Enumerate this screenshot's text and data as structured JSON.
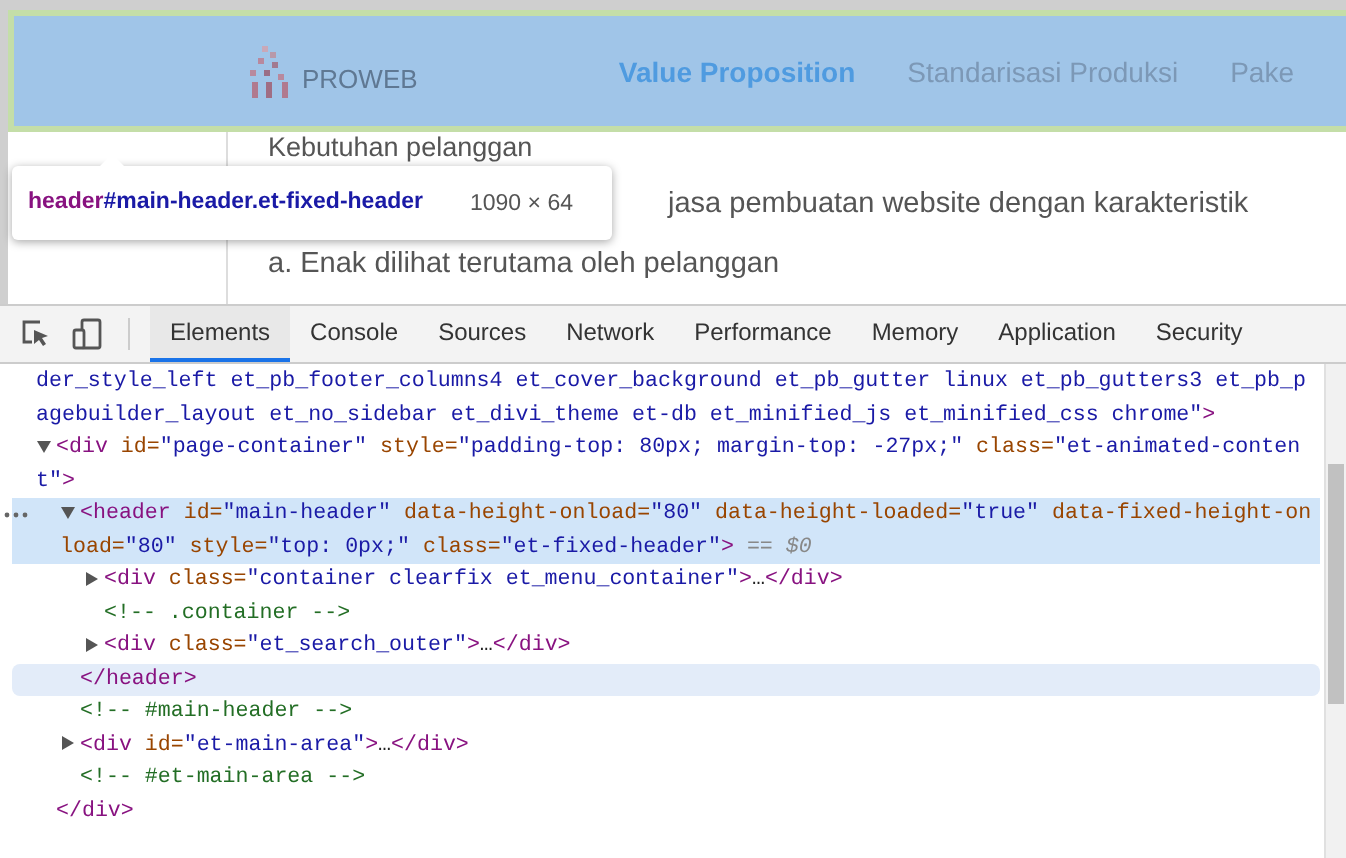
{
  "page": {
    "logo": "PROWEB",
    "nav": [
      {
        "label": "Value Proposition",
        "selected": true
      },
      {
        "label": "Standarisasi Produksi",
        "selected": false
      },
      {
        "label": "Pake",
        "selected": false
      }
    ],
    "content": [
      "Kebutuhan pelanggan",
      "jasa pembuatan website dengan karakteristik",
      "a. Enak dilihat terutama oleh pelanggan"
    ]
  },
  "tooltip": {
    "tag": "header",
    "selector": "#main-header.et-fixed-header",
    "size": "1090 × 64"
  },
  "devtools": {
    "tabs": [
      {
        "label": "Elements",
        "selected": true
      },
      {
        "label": "Console",
        "selected": false
      },
      {
        "label": "Sources",
        "selected": false
      },
      {
        "label": "Network",
        "selected": false
      },
      {
        "label": "Performance",
        "selected": false
      },
      {
        "label": "Memory",
        "selected": false
      },
      {
        "label": "Application",
        "selected": false
      },
      {
        "label": "Security",
        "selected": false
      }
    ],
    "dom": [
      {
        "kind": "text",
        "selected": false,
        "tokens": [
          {
            "value": "der_style_left et_pb_footer_columns4 et_cover_background et_pb_gutter linux et_pb_gutters3 et_pb_pagebuilder_layout et_no_sidebar et_divi_theme et-db et_minified_js et_minified_css chrome\""
          },
          {
            "tag": ">"
          }
        ]
      },
      {
        "kind": "element",
        "selected": false,
        "expanded": true,
        "close_hovered": false,
        "open": [
          {
            "tag": "<div"
          },
          {
            "attr": " id="
          },
          {
            "value": "\"page-container\""
          },
          {
            "attr": " style="
          },
          {
            "value": "\"padding-top: 80px; margin-top: -27px;\""
          },
          {
            "attr": " class="
          },
          {
            "value": "\"et-animated-content\""
          },
          {
            "tag": ">"
          }
        ],
        "children": [
          {
            "kind": "element",
            "selected": true,
            "expanded": true,
            "close_hovered": true,
            "open": [
              {
                "tag": "<header"
              },
              {
                "attr": " id="
              },
              {
                "value": "\"main-header\""
              },
              {
                "attr": " data-height-onload="
              },
              {
                "value": "\"80\""
              },
              {
                "attr": " data-height-loaded="
              },
              {
                "value": "\"true\""
              },
              {
                "attr": " data-fixed-height-onload="
              },
              {
                "value": "\"80\""
              },
              {
                "attr": " style="
              },
              {
                "value": "\"top: 0px;\""
              },
              {
                "attr": " class="
              },
              {
                "value": "\"et-fixed-header\""
              },
              {
                "tag": ">"
              },
              {
                "hint": " == $0"
              }
            ],
            "children": [
              {
                "kind": "element",
                "selected": false,
                "expanded": false,
                "open": [
                  {
                    "tag": "<div"
                  },
                  {
                    "attr": " class="
                  },
                  {
                    "value": "\"container clearfix et_menu_container\""
                  },
                  {
                    "tag": ">"
                  },
                  {
                    "text": "…"
                  },
                  {
                    "tag": "</div>"
                  }
                ]
              },
              {
                "kind": "comment",
                "selected": false,
                "tokens": [
                  {
                    "comment": "<!-- .container -->"
                  }
                ]
              },
              {
                "kind": "element",
                "selected": false,
                "expanded": false,
                "open": [
                  {
                    "tag": "<div"
                  },
                  {
                    "attr": " class="
                  },
                  {
                    "value": "\"et_search_outer\""
                  },
                  {
                    "tag": ">"
                  },
                  {
                    "text": "…"
                  },
                  {
                    "tag": "</div>"
                  }
                ]
              }
            ],
            "close": [
              {
                "tag": "</header>"
              }
            ]
          },
          {
            "kind": "comment",
            "selected": false,
            "tokens": [
              {
                "comment": "<!-- #main-header -->"
              }
            ]
          },
          {
            "kind": "element",
            "selected": false,
            "expanded": false,
            "open": [
              {
                "tag": "<div"
              },
              {
                "attr": " id="
              },
              {
                "value": "\"et-main-area\""
              },
              {
                "tag": ">"
              },
              {
                "text": "…"
              },
              {
                "tag": "</div>"
              }
            ]
          },
          {
            "kind": "comment",
            "selected": false,
            "tokens": [
              {
                "comment": "<!-- #et-main-area -->"
              }
            ]
          }
        ],
        "close": [
          {
            "tag": "</div>"
          }
        ]
      }
    ]
  }
}
